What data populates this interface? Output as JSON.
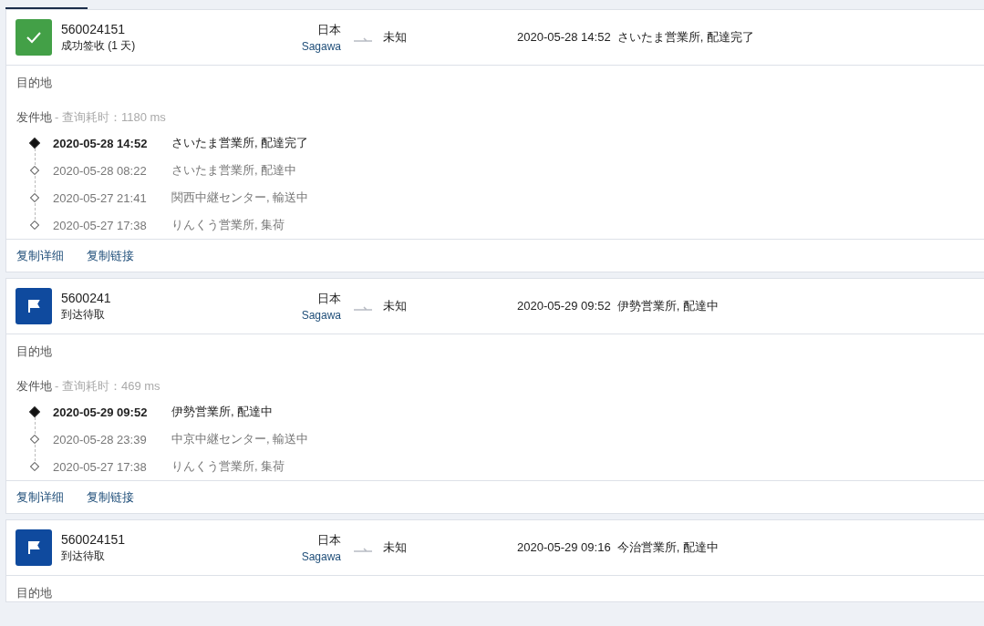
{
  "shipments": [
    {
      "kind": "delivered",
      "tracking_number": "560024151",
      "status": "成功签收 (1 天)",
      "origin": "日本",
      "carrier": "Sagawa",
      "destination": "未知",
      "latest": "2020-05-28 14:52  さいたま営業所, 配達完了",
      "destination_label": "目的地",
      "origin_label": "发件地",
      "query_time": "- 查询耗时：1180 ms",
      "events": [
        {
          "time": "2020-05-28 14:52",
          "text": "さいたま営業所, 配達完了",
          "current": true
        },
        {
          "time": "2020-05-28 08:22",
          "text": "さいたま営業所, 配達中",
          "current": false
        },
        {
          "time": "2020-05-27 21:41",
          "text": "関西中継センター, 輸送中",
          "current": false
        },
        {
          "time": "2020-05-27 17:38",
          "text": "りんくう営業所, 集荷",
          "current": false
        }
      ],
      "actions": [
        "复制详细",
        "复制链接"
      ]
    },
    {
      "kind": "pickup",
      "tracking_number": "5600241",
      "status": "到达待取",
      "origin": "日本",
      "carrier": "Sagawa",
      "destination": "未知",
      "latest": "2020-05-29 09:52  伊勢営業所, 配達中",
      "destination_label": "目的地",
      "origin_label": "发件地",
      "query_time": "- 查询耗时：469 ms",
      "events": [
        {
          "time": "2020-05-29 09:52",
          "text": "伊勢営業所, 配達中",
          "current": true
        },
        {
          "time": "2020-05-28 23:39",
          "text": "中京中継センター, 輸送中",
          "current": false
        },
        {
          "time": "2020-05-27 17:38",
          "text": "りんくう営業所, 集荷",
          "current": false
        }
      ],
      "actions": [
        "复制详细",
        "复制链接"
      ]
    },
    {
      "kind": "pickup",
      "tracking_number": "560024151",
      "status": "到达待取",
      "origin": "日本",
      "carrier": "Sagawa",
      "destination": "未知",
      "latest": "2020-05-29 09:16  今治営業所, 配達中",
      "destination_label": "目的地"
    }
  ]
}
